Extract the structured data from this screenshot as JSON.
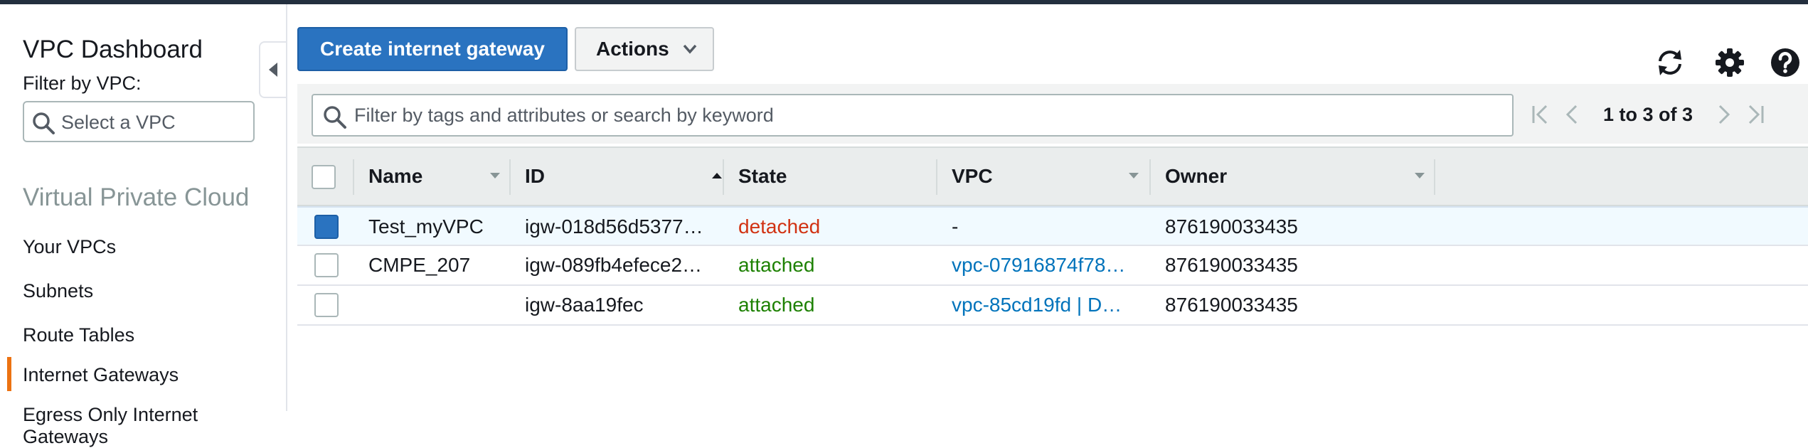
{
  "sidebar": {
    "title": "VPC Dashboard",
    "filter_label": "Filter by VPC:",
    "vpc_select_placeholder": "Select a VPC",
    "section_title": "Virtual Private Cloud",
    "items": [
      {
        "label": "Your VPCs"
      },
      {
        "label": "Subnets"
      },
      {
        "label": "Route Tables"
      },
      {
        "label": "Internet Gateways",
        "active": true
      },
      {
        "label": "Egress Only Internet Gateways"
      }
    ]
  },
  "toolbar": {
    "create_label": "Create internet gateway",
    "actions_label": "Actions",
    "icons": [
      "refresh-icon",
      "gear-icon",
      "help-icon"
    ]
  },
  "filter": {
    "placeholder": "Filter by tags and attributes or search by keyword",
    "pagination": "1 to 3 of 3"
  },
  "table": {
    "columns": [
      "Name",
      "ID",
      "State",
      "VPC",
      "Owner"
    ],
    "sorted_column": "ID",
    "rows": [
      {
        "selected": true,
        "name": "Test_myVPC",
        "id": "igw-018d56d5377…",
        "state": "detached",
        "vpc": "-",
        "owner": "876190033435"
      },
      {
        "selected": false,
        "name": "CMPE_207",
        "id": "igw-089fb4efece2…",
        "state": "attached",
        "vpc": "vpc-07916874f78…",
        "owner": "876190033435"
      },
      {
        "selected": false,
        "name": "",
        "id": "igw-8aa19fec",
        "state": "attached",
        "vpc": "vpc-85cd19fd | D…",
        "owner": "876190033435"
      }
    ]
  },
  "colors": {
    "primary": "#2a73c0",
    "detached": "#d13212",
    "attached": "#1d8102",
    "link": "#0073bb",
    "active_indicator": "#ec7211"
  }
}
